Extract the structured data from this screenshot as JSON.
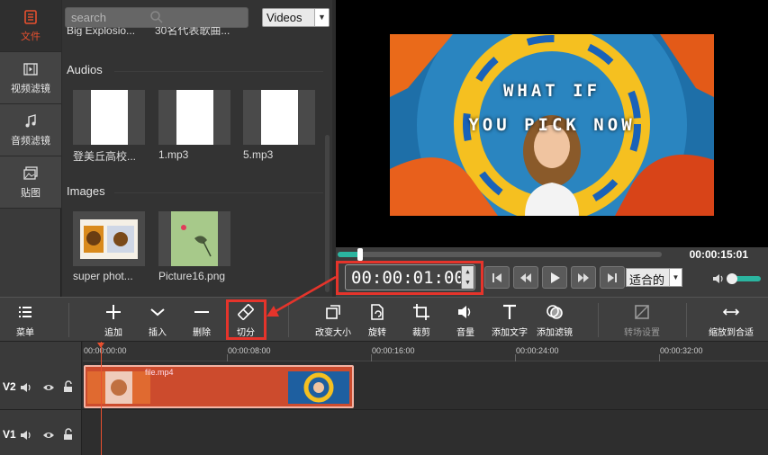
{
  "sidebar": {
    "tabs": [
      {
        "label": "文件",
        "icon": "file-list-icon",
        "active": true
      },
      {
        "label": "视频滤镜",
        "icon": "film-icon",
        "active": false
      },
      {
        "label": "音频滤镜",
        "icon": "music-note-icon",
        "active": false
      },
      {
        "label": "贴图",
        "icon": "image-stack-icon",
        "active": false
      }
    ]
  },
  "library": {
    "search_placeholder": "search",
    "filter_value": "Videos",
    "cut_items": [
      "Big Explosio...",
      "30名代表歌曲..."
    ],
    "audios_title": "Audios",
    "audios": [
      {
        "label": "登美丘高校..."
      },
      {
        "label": "1.mp3"
      },
      {
        "label": "5.mp3"
      }
    ],
    "images_title": "Images",
    "images": [
      {
        "label": "super phot..."
      },
      {
        "label": "Picture16.png"
      }
    ]
  },
  "preview": {
    "overlay_line1": "WHAT IF",
    "overlay_line2": "YOU PICK NOW"
  },
  "playback": {
    "progress": 0.07,
    "duration": "00:00:15:01",
    "timecode": "00:00:01:00",
    "fit_value": "适合的",
    "volume": 0.9
  },
  "toolbar": {
    "menu": "菜单",
    "add": "追加",
    "insert": "插入",
    "delete": "删除",
    "split": "切分",
    "resize": "改变大小",
    "rotate": "旋转",
    "crop": "裁剪",
    "volume": "音量",
    "add_text": "添加文字",
    "add_filter": "添加滤镜",
    "transition": "转场设置",
    "zoom_fit": "缩放到合适"
  },
  "timeline": {
    "ruler": [
      "00:00:00:00",
      "00:00:08:00",
      "00:00:16:00",
      "00:00:24:00",
      "00:00:32:00"
    ],
    "tracks": [
      {
        "label": "V2"
      },
      {
        "label": "V1"
      }
    ],
    "clip_name": "file.mp4"
  },
  "colors": {
    "accent": "#e8502f",
    "highlight": "#e5342b",
    "progress": "#2bb5a0",
    "clip": "#cc4b2d"
  }
}
